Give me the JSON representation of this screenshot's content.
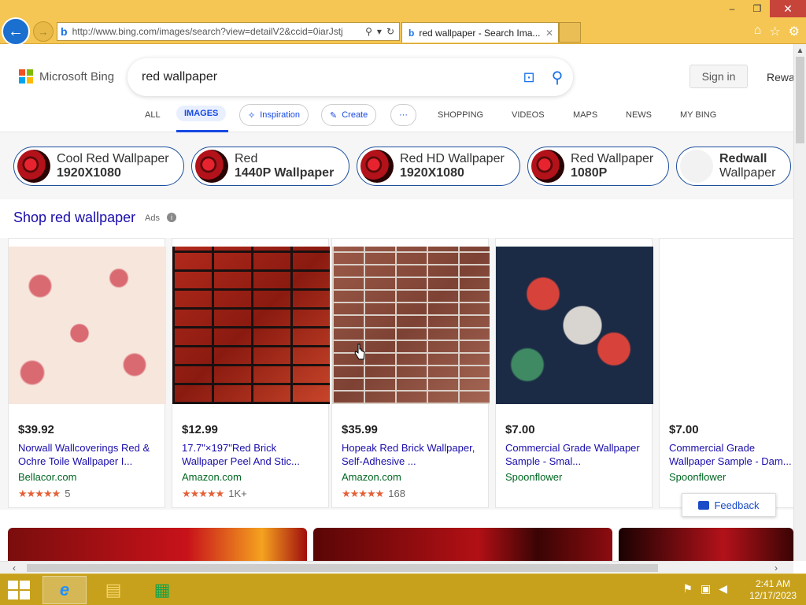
{
  "browser": {
    "url": "http://www.bing.com/images/search?view=detailV2&ccid=0iarJstj",
    "tab_title": "red wallpaper - Search Ima...",
    "window_controls": {
      "minimize": "‒",
      "restore": "❐",
      "close": "✕"
    }
  },
  "header": {
    "logo_text": "Microsoft Bing",
    "search_query": "red wallpaper",
    "signin_label": "Sign in",
    "rewards_label": "Rewa"
  },
  "nav": {
    "items": [
      "ALL",
      "IMAGES",
      "Inspiration",
      "Create",
      "···",
      "SHOPPING",
      "VIDEOS",
      "MAPS",
      "NEWS",
      "MY BING"
    ]
  },
  "chips": [
    {
      "line1": "Cool Red Wallpaper",
      "line2": "1920X1080"
    },
    {
      "line1": "Red",
      "line2": "1440P Wallpaper"
    },
    {
      "line1": "Red HD Wallpaper",
      "line2": "1920X1080"
    },
    {
      "line1": "Red Wallpaper",
      "line2": "1080P"
    },
    {
      "line1": "Redwall",
      "line2": "Wallpaper"
    }
  ],
  "shop": {
    "title": "Shop red wallpaper",
    "ads_label": "Ads",
    "info_label": "i"
  },
  "products": [
    {
      "price": "$39.92",
      "name": "Norwall Wallcoverings Red & Ochre Toile Wallpaper I...",
      "store": "Bellacor.com",
      "stars": "★★★★★",
      "reviews": "5"
    },
    {
      "price": "$12.99",
      "name": "17.7\"×197\"Red Brick Wallpaper Peel And Stic...",
      "store": "Amazon.com",
      "stars": "★★★★★",
      "reviews": "1K+"
    },
    {
      "price": "$35.99",
      "name": "Hopeak Red Brick Wallpaper, Self-Adhesive ...",
      "store": "Amazon.com",
      "stars": "★★★★★",
      "reviews": "168"
    },
    {
      "price": "$7.00",
      "name": "Commercial Grade Wallpaper Sample - Smal...",
      "store": "Spoonflower",
      "stars": "",
      "reviews": ""
    },
    {
      "price": "$7.00",
      "name": "Commercial Grade Wallpaper Sample - Dam...",
      "store": "Spoonflower",
      "stars": "",
      "reviews": ""
    }
  ],
  "feedback_label": "Feedback",
  "taskbar": {
    "time": "2:41 AM",
    "date": "12/17/2023"
  },
  "colors": {
    "ie_chrome": "#f5c653",
    "bing_blue": "#174ae4",
    "link": "#1a0dab",
    "store_green": "#006621",
    "taskbar": "#c7a11c"
  }
}
